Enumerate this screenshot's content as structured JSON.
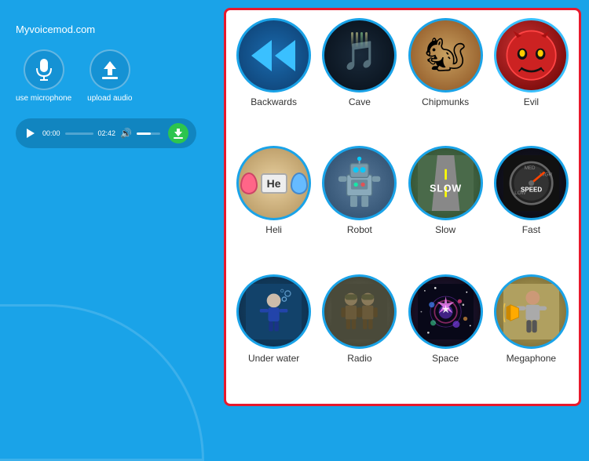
{
  "site": {
    "title": "Myvoicemod.com"
  },
  "controls": {
    "microphone_label": "use microphone",
    "upload_label": "upload audio"
  },
  "player": {
    "current_time": "00:00",
    "total_time": "02:42",
    "progress": 0
  },
  "effects": [
    {
      "id": "backwards",
      "label": "Backwards",
      "type": "backwards"
    },
    {
      "id": "cave",
      "label": "Cave",
      "type": "cave"
    },
    {
      "id": "chipmunks",
      "label": "Chipmunks",
      "type": "chipmunks"
    },
    {
      "id": "evil",
      "label": "Evil",
      "type": "evil"
    },
    {
      "id": "heli",
      "label": "Heli",
      "type": "heli"
    },
    {
      "id": "robot",
      "label": "Robot",
      "type": "robot"
    },
    {
      "id": "slow",
      "label": "Slow",
      "type": "slow"
    },
    {
      "id": "fast",
      "label": "Fast",
      "type": "fast"
    },
    {
      "id": "underwater",
      "label": "Under water",
      "type": "underwater"
    },
    {
      "id": "radio",
      "label": "Radio",
      "type": "radio"
    },
    {
      "id": "space",
      "label": "Space",
      "type": "space"
    },
    {
      "id": "megaphone",
      "label": "Megaphone",
      "type": "megaphone"
    }
  ],
  "icons": {
    "play": "▶",
    "download": "↓",
    "volume": "🔊"
  }
}
